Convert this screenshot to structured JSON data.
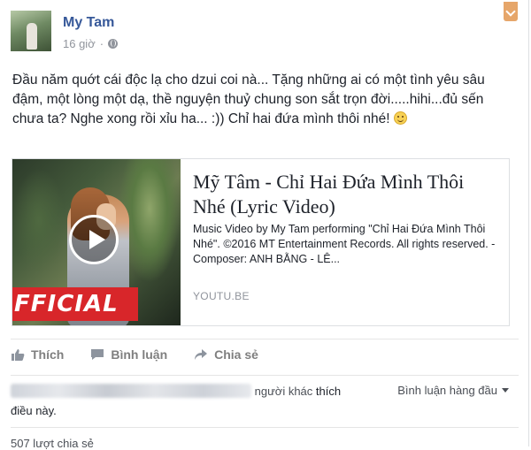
{
  "post": {
    "author": "My Tam",
    "time": "16 giờ",
    "separator": "·",
    "text": "Đầu năm quớt cái độc lạ cho dzui coi nà... Tặng những ai có một tình yêu sâu đậm, một lòng một dạ, thề nguyện thuỷ chung son sắt trọn đời.....hihi...đủ sến chưa ta? Nghe xong rồi xỉu ha... :)) Chỉ hai đứa mình thôi nhé!"
  },
  "link": {
    "title": "Mỹ Tâm - Chỉ Hai Đứa Mình Thôi Nhé (Lyric Video)",
    "description": "Music Video by My Tam performing \"Chỉ Hai Đứa Mình Thôi Nhé\". ©2016 MT Entertainment Records. All rights reserved. - Composer: ANH BẰNG - LÊ...",
    "domain": "YOUTU.BE",
    "thumbnail_banner": "FFICIAL"
  },
  "actions": {
    "like": "Thích",
    "comment": "Bình luận",
    "share": "Chia sẻ"
  },
  "reactions": {
    "others_text": "người khác",
    "like_word": "thích",
    "line2": "điều này.",
    "sort_label": "Bình luận hàng đầu"
  },
  "shares": {
    "text": "507 lượt chia sẻ"
  },
  "colors": {
    "link_blue": "#365899",
    "banner_red": "#d8262a",
    "muted_gray": "#90949c"
  },
  "icons": [
    "globe-icon",
    "chevron-down-icon",
    "smiley-icon",
    "play-icon",
    "like-icon",
    "comment-icon",
    "share-icon",
    "caret-down-icon"
  ]
}
